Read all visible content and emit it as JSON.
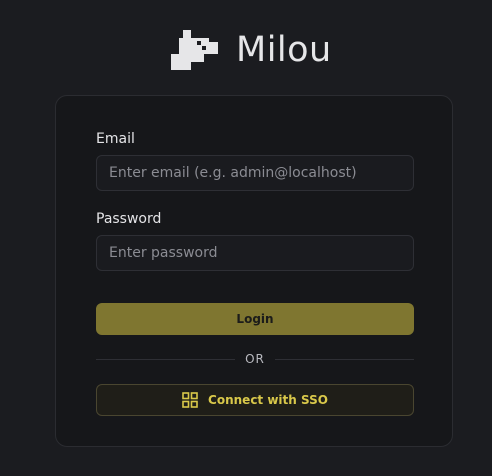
{
  "brand": {
    "name": "Milou",
    "logo_icon": "milou-dog-logo-icon"
  },
  "login_form": {
    "email": {
      "label": "Email",
      "placeholder": "Enter email (e.g. admin@localhost)",
      "value": ""
    },
    "password": {
      "label": "Password",
      "placeholder": "Enter password",
      "value": ""
    },
    "login_button_label": "Login",
    "divider_text": "OR",
    "sso_button": {
      "label": "Connect with SSO",
      "icon": "grid-icon"
    }
  },
  "colors": {
    "background": "#1b1c20",
    "card_background": "#16171a",
    "accent": "#7f7630",
    "sso_text": "#d9c84a"
  }
}
